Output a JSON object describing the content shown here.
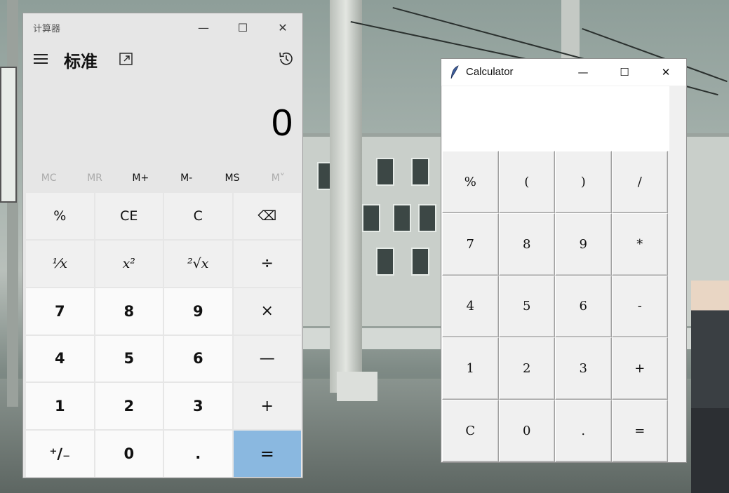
{
  "win_calculator": {
    "title": "计算器",
    "mode": "标准",
    "display": "0",
    "caption": {
      "minimize": "—",
      "maximize": "☐",
      "close": "✕"
    },
    "memory": [
      "MC",
      "MR",
      "M+",
      "M-",
      "MS",
      "M˅"
    ],
    "memory_disabled": [
      true,
      true,
      false,
      false,
      false,
      true
    ],
    "keys": [
      {
        "label": "%",
        "kind": "fn"
      },
      {
        "label": "CE",
        "kind": "fn"
      },
      {
        "label": "C",
        "kind": "fn"
      },
      {
        "label": "⌫",
        "kind": "fn"
      },
      {
        "label": "¹⁄x",
        "kind": "fn it"
      },
      {
        "label": "x²",
        "kind": "fn it"
      },
      {
        "label": "²√x",
        "kind": "fn it"
      },
      {
        "label": "÷",
        "kind": "op"
      },
      {
        "label": "7",
        "kind": "num"
      },
      {
        "label": "8",
        "kind": "num"
      },
      {
        "label": "9",
        "kind": "num"
      },
      {
        "label": "×",
        "kind": "op"
      },
      {
        "label": "4",
        "kind": "num"
      },
      {
        "label": "5",
        "kind": "num"
      },
      {
        "label": "6",
        "kind": "num"
      },
      {
        "label": "—",
        "kind": "op"
      },
      {
        "label": "1",
        "kind": "num"
      },
      {
        "label": "2",
        "kind": "num"
      },
      {
        "label": "3",
        "kind": "num"
      },
      {
        "label": "+",
        "kind": "op"
      },
      {
        "label": "⁺∕₋",
        "kind": "num"
      },
      {
        "label": "0",
        "kind": "num"
      },
      {
        "label": ".",
        "kind": "num"
      },
      {
        "label": "=",
        "kind": "eq"
      }
    ],
    "accent_color": "#8ab8e0"
  },
  "tk_calculator": {
    "title": "Calculator",
    "caption": {
      "minimize": "—",
      "maximize": "☐",
      "close": "✕"
    },
    "entry_value": "",
    "keys": [
      "%",
      "(",
      ")",
      "/",
      "7",
      "8",
      "9",
      "*",
      "4",
      "5",
      "6",
      "-",
      "1",
      "2",
      "3",
      "+",
      "C",
      "0",
      ".",
      "="
    ]
  }
}
